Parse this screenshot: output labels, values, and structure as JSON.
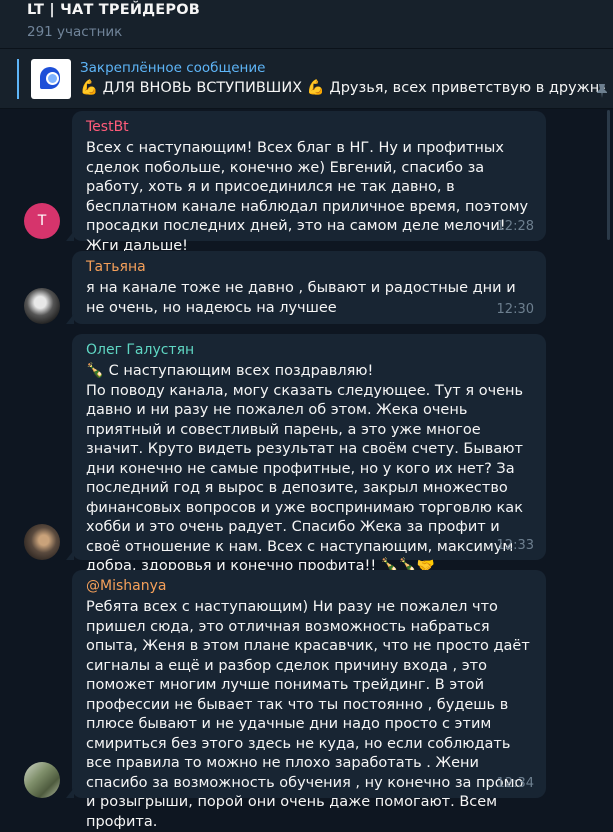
{
  "header": {
    "title": "LT | ЧАТ ТРЕЙДЕРОВ",
    "subtitle": "291 участник"
  },
  "pinned": {
    "label": "Закреплённое сообщение",
    "text": "💪 ДЛЯ ВНОВЬ ВСТУПИВШИХ 💪 Друзья, всех приветствую в дружный кол",
    "icon": "pin-icon"
  },
  "colors": {
    "background": "#0e1621",
    "bubble": "#182533",
    "header": "#17212b",
    "link": "#5eb5f7"
  },
  "messages": [
    {
      "sender": "TestBt",
      "sender_color": "#ff5c7a",
      "avatar_letter": "T",
      "text": "Всех с наступающим! Всех благ в НГ. Ну и профитных сделок побольше, конечно же) Евгений, спасибо за работу, хоть я и присоединился не так давно, в бесплатном канале наблюдал приличное время, поэтому просадки последних дней, это на самом деле мелочи! Жги дальше!",
      "time": "12:28"
    },
    {
      "sender": "Татьяна",
      "sender_color": "#f5a05a",
      "text": "я на канале тоже не давно , бывают и радостные дни и не очень, но надеюсь на лучшее",
      "time": "12:30"
    },
    {
      "sender": "Олег Галустян",
      "sender_color": "#5fd6c3",
      "text": "🍾 С наступающим всех поздравляю!\nПо поводу канала, могу сказать следующее. Тут я очень давно и ни разу не пожалел об этом. Жека очень приятный и совестливый парень, а это уже многое значит. Круто видеть результат на своём счету. Бывают дни конечно не самые профитные, но у кого их нет? За последний год я вырос в депозите, закрыл множество финансовых вопросов и уже воспринимаю торговлю как хобби и это очень радует. Спасибо Жека за профит и своё отношение к нам. Всех с наступающим, максимум добра, здоровья и конечно профита!! 🍾🍾🤝",
      "time": "12:33"
    },
    {
      "sender": "@Mishanya",
      "sender_color": "#f5a05a",
      "text": "Ребята всех с наступающим) Ни разу не пожалел что пришел сюда, это отличная возможность набраться опыта, Женя в этом плане красавчик, что не просто даёт сигналы а ещё и разбор сделок причину входа , это поможет многим лучше понимать трейдинг. В этой профессии не бывает так что ты постоянно , будешь в плюсе бывают и не удачные дни надо просто с этим смириться без этого здесь не куда, но если соблюдать все правила то можно не плохо заработать . Жени спасибо за возможность обучения , ну конечно за промо и розыгрыши, порой они очень даже помогают. Всем профита.",
      "time": "12:34"
    }
  ]
}
